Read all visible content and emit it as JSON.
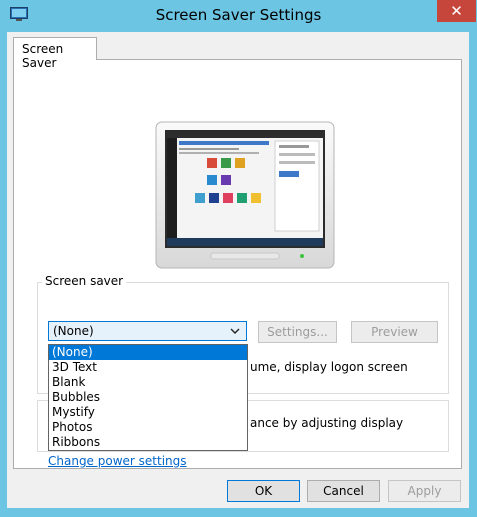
{
  "window": {
    "title": "Screen Saver Settings",
    "close_glyph": "✕"
  },
  "tabs": [
    {
      "label": "Screen Saver"
    }
  ],
  "screen_saver": {
    "group_label": "Screen saver",
    "selected": "(None)",
    "settings_label": "Settings...",
    "preview_label": "Preview",
    "options": [
      "(None)",
      "3D Text",
      "Blank",
      "Bubbles",
      "Mystify",
      "Photos",
      "Ribbons"
    ],
    "logon_text_visible": "ume, display logon screen"
  },
  "power": {
    "text_visible": "ance by adjusting display",
    "link_label": "Change power settings"
  },
  "footer": {
    "ok_label": "OK",
    "cancel_label": "Cancel",
    "apply_label": "Apply"
  },
  "colors": {
    "accent": "#0078d7",
    "titlebar": "#6cc5e3",
    "close": "#c7463c"
  }
}
